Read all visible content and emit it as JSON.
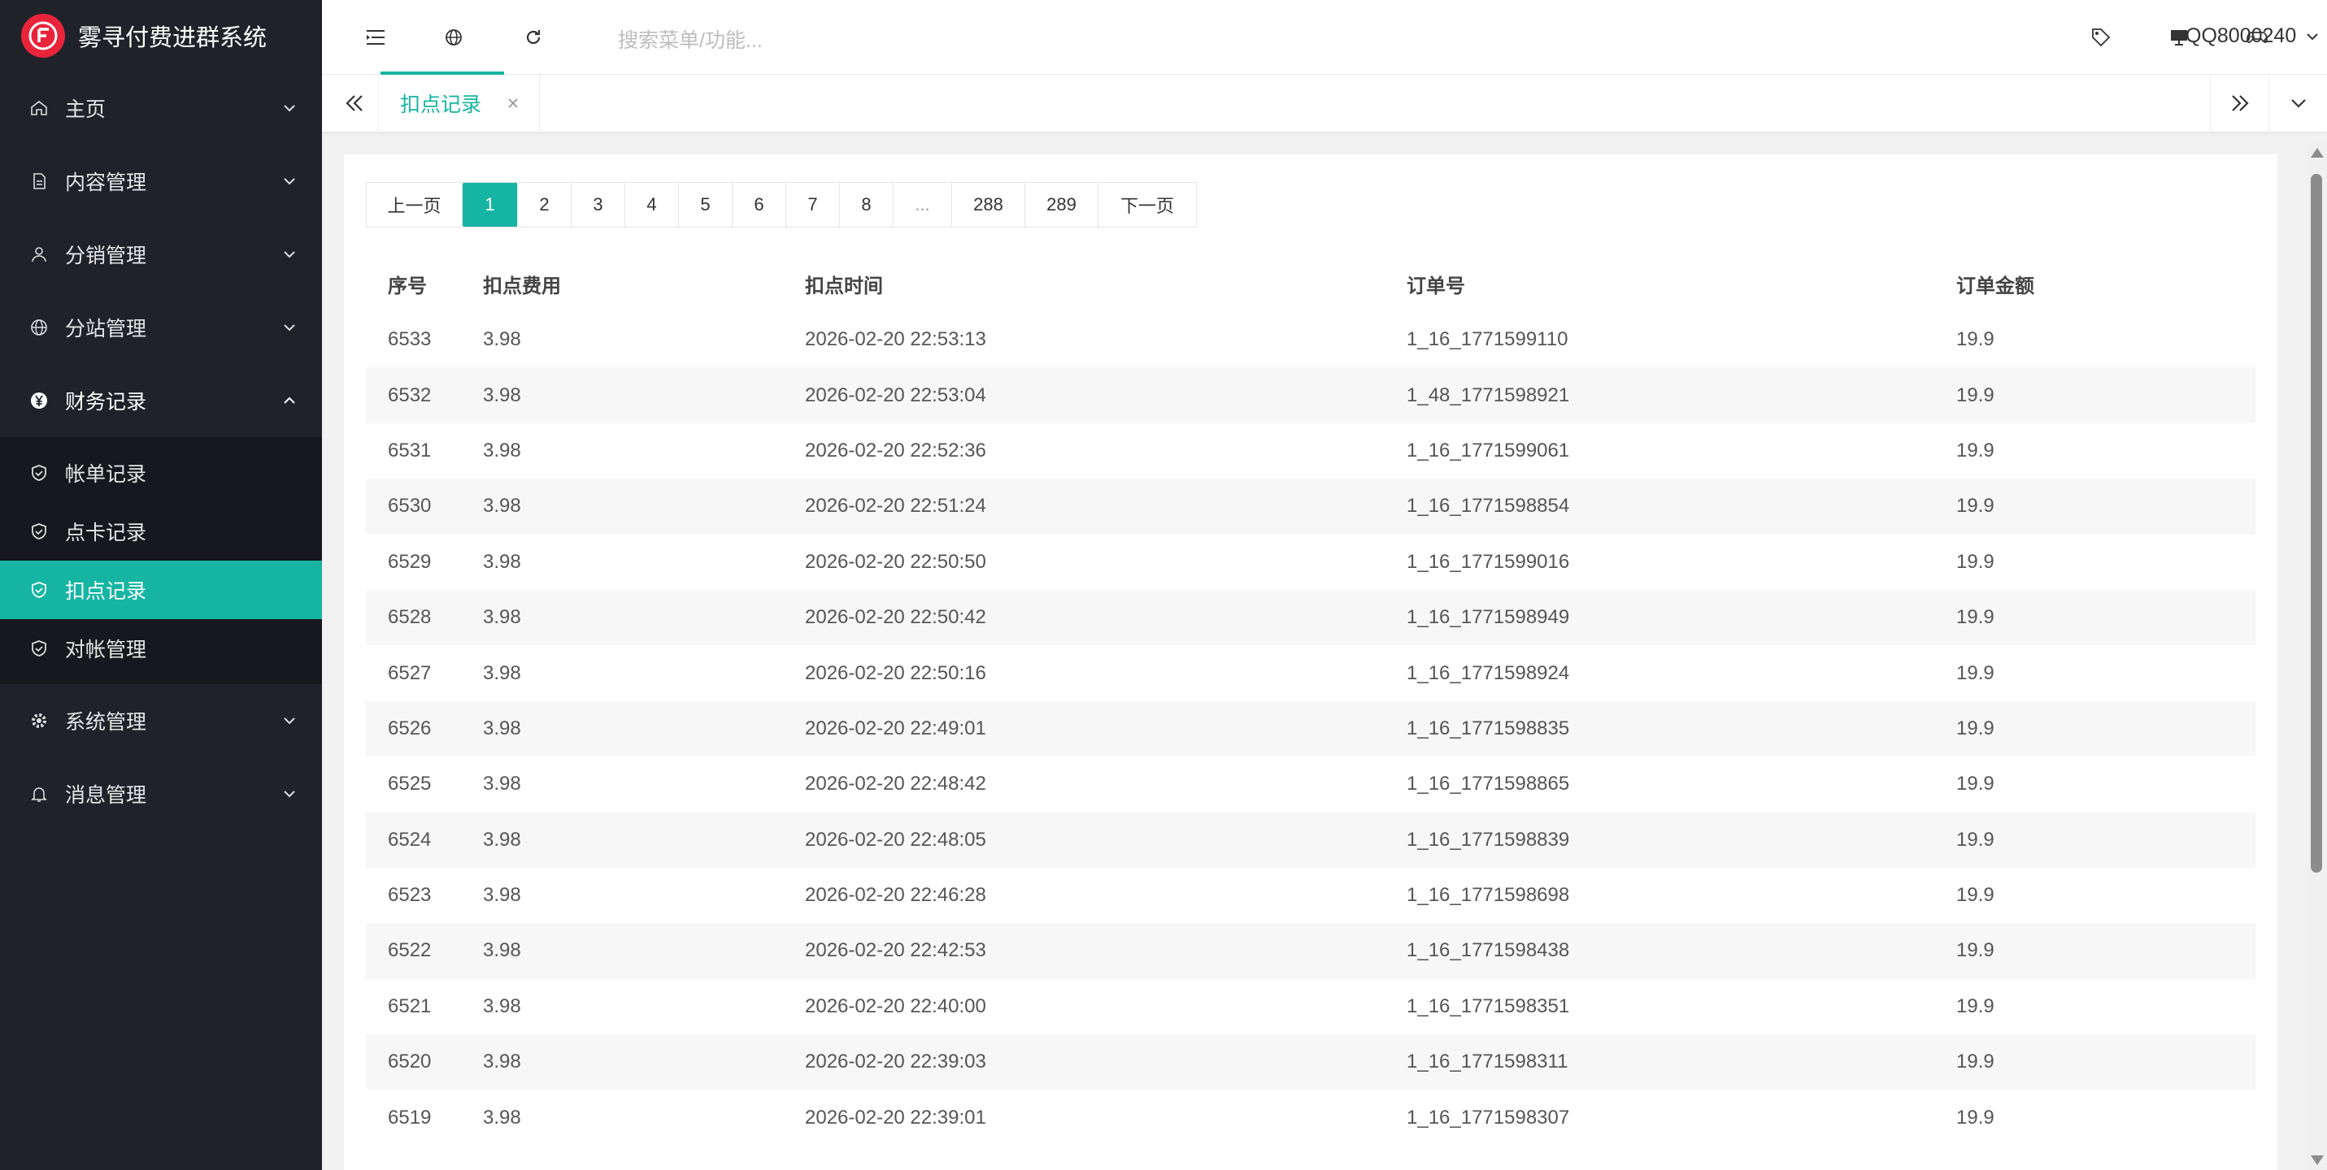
{
  "app": {
    "title": "雾寻付费进群系统"
  },
  "sidebar": {
    "items": [
      {
        "label": "主页",
        "icon": "home-icon"
      },
      {
        "label": "内容管理",
        "icon": "document-icon"
      },
      {
        "label": "分销管理",
        "icon": "user-icon"
      },
      {
        "label": "分站管理",
        "icon": "globe-icon"
      },
      {
        "label": "财务记录",
        "icon": "yen-icon",
        "open": true
      },
      {
        "label": "系统管理",
        "icon": "gear-icon"
      },
      {
        "label": "消息管理",
        "icon": "bell-icon"
      }
    ],
    "finance_sub": [
      {
        "label": "帐单记录"
      },
      {
        "label": "点卡记录"
      },
      {
        "label": "扣点记录",
        "active": true
      },
      {
        "label": "对帐管理"
      }
    ]
  },
  "header": {
    "search_placeholder": "搜索菜单/功能...",
    "user": "QQ8000240"
  },
  "tabs": [
    {
      "label": "扣点记录"
    }
  ],
  "pagination": {
    "prev": "上一页",
    "next": "下一页",
    "pages": [
      "1",
      "2",
      "3",
      "4",
      "5",
      "6",
      "7",
      "8",
      "...",
      "288",
      "289"
    ],
    "current": "1"
  },
  "table": {
    "headers": [
      "序号",
      "扣点费用",
      "扣点时间",
      "订单号",
      "订单金额"
    ],
    "rows": [
      [
        "6533",
        "3.98",
        "2026-02-20 22:53:13",
        "1_16_1771599110",
        "19.9"
      ],
      [
        "6532",
        "3.98",
        "2026-02-20 22:53:04",
        "1_48_1771598921",
        "19.9"
      ],
      [
        "6531",
        "3.98",
        "2026-02-20 22:52:36",
        "1_16_1771599061",
        "19.9"
      ],
      [
        "6530",
        "3.98",
        "2026-02-20 22:51:24",
        "1_16_1771598854",
        "19.9"
      ],
      [
        "6529",
        "3.98",
        "2026-02-20 22:50:50",
        "1_16_1771599016",
        "19.9"
      ],
      [
        "6528",
        "3.98",
        "2026-02-20 22:50:42",
        "1_16_1771598949",
        "19.9"
      ],
      [
        "6527",
        "3.98",
        "2026-02-20 22:50:16",
        "1_16_1771598924",
        "19.9"
      ],
      [
        "6526",
        "3.98",
        "2026-02-20 22:49:01",
        "1_16_1771598835",
        "19.9"
      ],
      [
        "6525",
        "3.98",
        "2026-02-20 22:48:42",
        "1_16_1771598865",
        "19.9"
      ],
      [
        "6524",
        "3.98",
        "2026-02-20 22:48:05",
        "1_16_1771598839",
        "19.9"
      ],
      [
        "6523",
        "3.98",
        "2026-02-20 22:46:28",
        "1_16_1771598698",
        "19.9"
      ],
      [
        "6522",
        "3.98",
        "2026-02-20 22:42:53",
        "1_16_1771598438",
        "19.9"
      ],
      [
        "6521",
        "3.98",
        "2026-02-20 22:40:00",
        "1_16_1771598351",
        "19.9"
      ],
      [
        "6520",
        "3.98",
        "2026-02-20 22:39:03",
        "1_16_1771598311",
        "19.9"
      ],
      [
        "6519",
        "3.98",
        "2026-02-20 22:39:01",
        "1_16_1771598307",
        "19.9"
      ]
    ]
  },
  "colors": {
    "accent": "#16b5a3",
    "sidebar": "#20222a",
    "logo": "#e8243b"
  }
}
